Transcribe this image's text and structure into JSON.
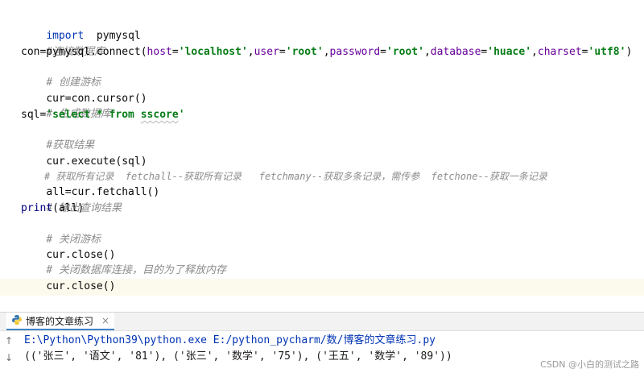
{
  "editor": {
    "lines": [
      {
        "kw": "import",
        "rest": "  pymysql"
      },
      {
        "comment": "#连接数据库"
      },
      {
        "pre": "con=pymysql.connect(",
        "p1": "host",
        "eq1": "=",
        "s1": "'localhost'",
        "c1": ",",
        "p2": "user",
        "eq2": "=",
        "s2": "'root'",
        "c2": ",",
        "p3": "password",
        "eq3": "=",
        "s3": "'root'",
        "c3": ",",
        "p4": "database",
        "eq4": "=",
        "s4": "'huace'",
        "c4": ",",
        "p5": "charset",
        "eq5": "=",
        "s5": "'utf8'",
        "post": ")"
      },
      {
        "comment": "# 创建游标"
      },
      {
        "text": "cur=con.cursor()"
      },
      {
        "comment": "# 生成数据库"
      },
      {
        "pre": "sql=",
        "s_open": "'select * from ",
        "s_wavy": "sscore",
        "s_close": "'"
      },
      {
        "comment": "#获取结果"
      },
      {
        "text": "cur.execute(sql)"
      },
      {
        "comment": "# 获取所有记录  fetchall--获取所有记录   fetchmany--获取多条记录，需传参  fetchone--获取一条记录"
      },
      {
        "text": "all=cur.fetchall()"
      },
      {
        "comment": "# 输出查询结果"
      },
      {
        "bi": "print",
        "rest": "(all)"
      },
      {
        "comment": "# 关闭游标"
      },
      {
        "text": "cur.close()"
      },
      {
        "comment": "# 关闭数据库连接，目的为了释放内存"
      },
      {
        "text": "cur.close()"
      }
    ]
  },
  "run_panel": {
    "tab_label": "博客的文章练习",
    "tab_icon": "python-icon",
    "console": {
      "command": "E:\\Python\\Python39\\python.exe E:/python_pycharm/数/博客的文章练习.py",
      "output": "(('张三', '语文', '81'), ('张三', '数学', '75'), ('王五', '数学', '89'))"
    }
  },
  "watermark": "CSDN @小白的测试之路",
  "colors": {
    "keyword": "#0033b3",
    "string": "#067d17",
    "parameter": "#660099",
    "comment": "#8c8c8c",
    "caret_line": "#fcfaed"
  }
}
